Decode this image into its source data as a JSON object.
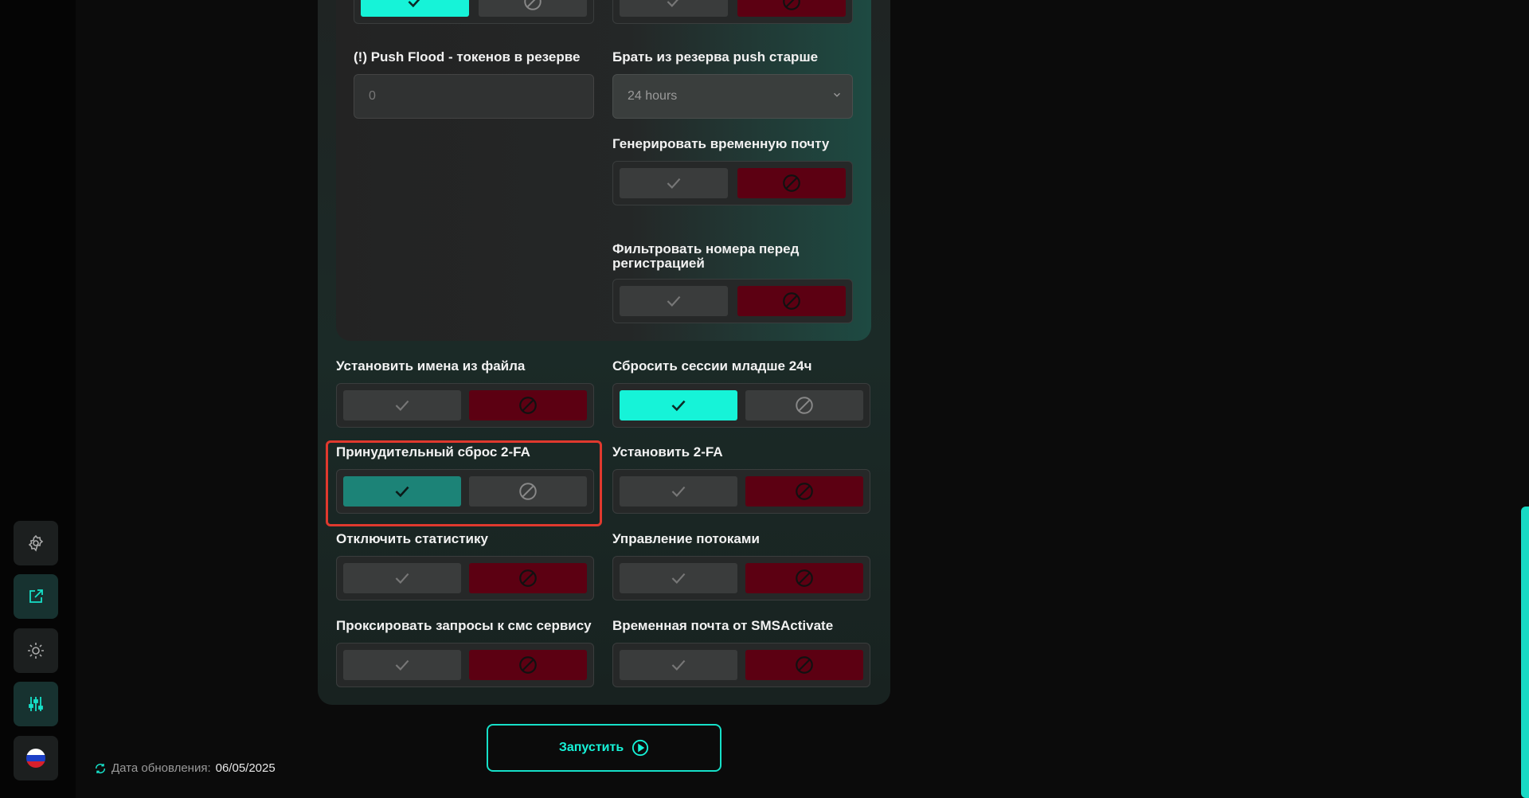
{
  "sidebar": {
    "buttons": [
      {
        "icon": "gear-icon"
      },
      {
        "icon": "external-link-icon"
      },
      {
        "icon": "sun-icon"
      },
      {
        "icon": "sliders-icon"
      },
      {
        "icon": "russia-flag-icon"
      }
    ]
  },
  "footer": {
    "update_label": "Дата обновления:",
    "update_value": "06/05/2025"
  },
  "inner": {
    "push_flood_label": "(!) Push Flood - токенов в резерве",
    "push_flood_placeholder": "0",
    "reserve_label": "Брать из резерва push старше",
    "reserve_value": "24 hours",
    "temp_mail_label": "Генерировать временную почту",
    "filter_label_line1": "Фильтровать номера перед",
    "filter_label_line2": "регистрацией"
  },
  "settings": {
    "names_from_file": "Установить имена из файла",
    "reset_sessions": "Сбросить сессии младше 24ч",
    "force_reset_2fa": "Принудительный сброс 2-FA",
    "set_2fa": "Установить 2-FA",
    "disable_stats": "Отключить статистику",
    "thread_control": "Управление потоками",
    "proxy_sms": "Проксировать запросы к смс сервису",
    "temp_mail_sms": "Временная почта от SMSActivate"
  },
  "run_button": {
    "label": "Запустить"
  },
  "colors": {
    "accent": "#16f3d8",
    "danger": "#5c0012",
    "highlight": "#e0392e"
  }
}
